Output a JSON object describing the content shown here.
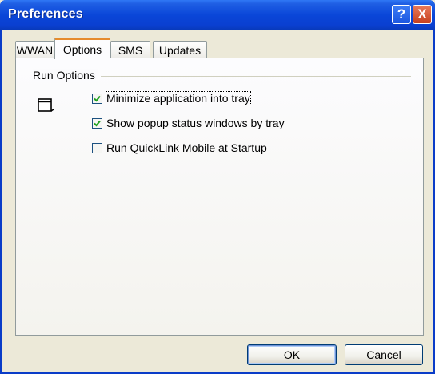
{
  "window": {
    "title": "Preferences",
    "help_label": "?",
    "close_label": "X"
  },
  "tabs": [
    {
      "label": "WWAN",
      "active": false
    },
    {
      "label": "Options",
      "active": true
    },
    {
      "label": "SMS",
      "active": false
    },
    {
      "label": "Updates",
      "active": false
    }
  ],
  "group": {
    "label": "Run Options",
    "icon": "application-window-icon"
  },
  "options": [
    {
      "label": "Minimize application into tray",
      "checked": true
    },
    {
      "label": "Show popup status windows by tray",
      "checked": true
    },
    {
      "label": "Run QuickLink Mobile at Startup",
      "checked": false
    }
  ],
  "buttons": {
    "ok": "OK",
    "cancel": "Cancel"
  },
  "colors": {
    "titlebar": "#0a46d8",
    "active_tab_accent": "#e68b2c",
    "checkmark": "#21a121"
  }
}
